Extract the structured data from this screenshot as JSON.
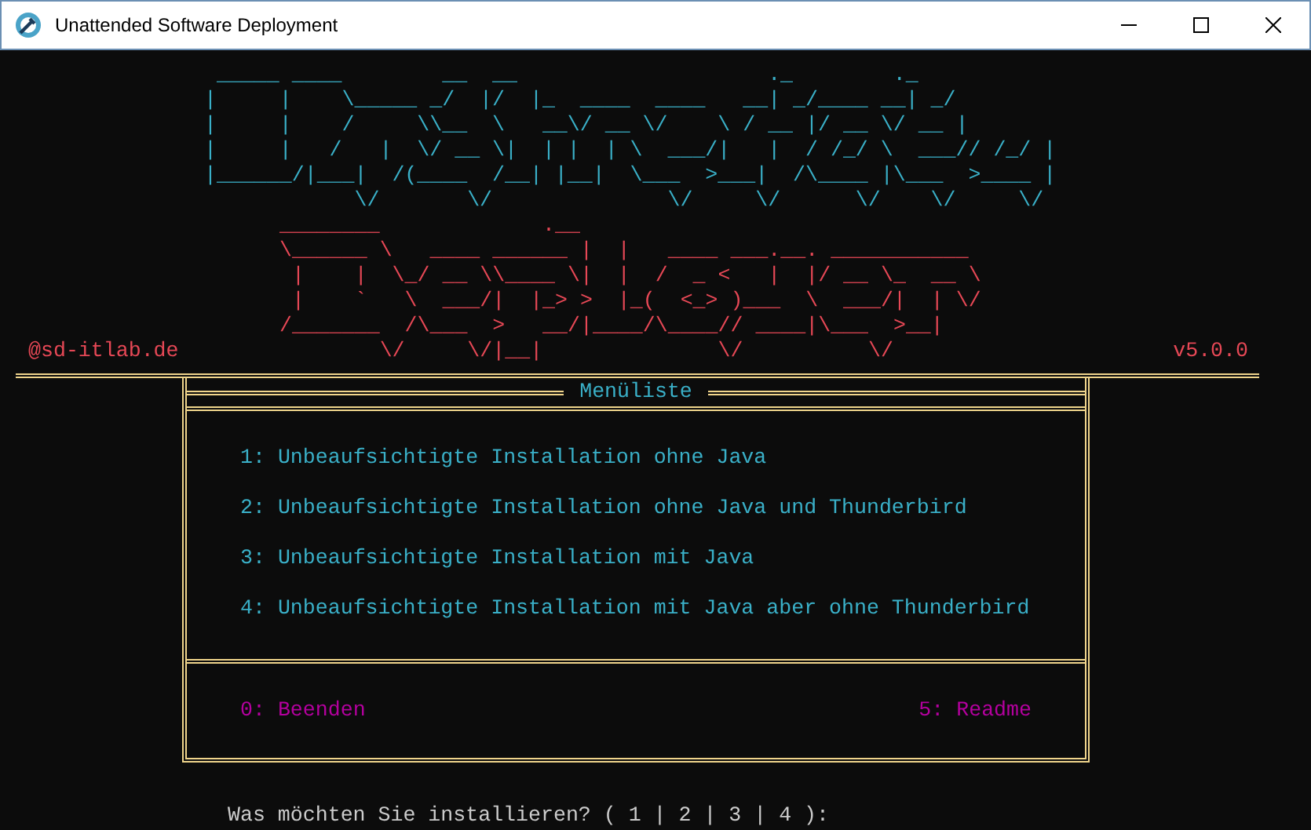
{
  "window": {
    "title": "Unattended Software Deployment"
  },
  "banner_top": [
    " _____ ____        __  __                    ._        ._",
    "|     |    \\_____ _/  |/  |_  ____  ____   __| _/____ __| _/",
    "|     |    /     \\\\__  \\   __\\/ __ \\/    \\ / __ |/ __ \\/ __ |",
    "|     |   /   |  \\/ __ \\|  | |  | \\  ___/|   |  / /_/ \\  ___// /_/ |",
    "|______/|___|  /(____  /__| |__|  \\___  >___|  /\\____ |\\___  >____ |",
    "            \\/       \\/              \\/     \\/      \\/    \\/     \\/"
  ],
  "banner_bottom": [
    " ________             .__",
    " \\______ \\   ____ ______ |  |   ____ ___.__. ___________",
    "  |    |  \\_/ __ \\\\____ \\|  |  /  _ <   |  |/ __ \\_  __ \\",
    "  |    `   \\  ___/|  |_> >  |_(  <_> )___  \\  ___/|  | \\/",
    " /_______  /\\___  >   __/|____/\\____// ____|\\___  >__|",
    "         \\/     \\/|__|              \\/          \\/"
  ],
  "tag": "@sd-itlab.de",
  "version": "v5.0.0",
  "menu": {
    "title": "Menüliste",
    "options": [
      "1: Unbeaufsichtigte Installation ohne Java",
      "2: Unbeaufsichtigte Installation ohne Java und Thunderbird",
      "3: Unbeaufsichtigte Installation mit Java",
      "4: Unbeaufsichtigte Installation mit Java aber ohne Thunderbird"
    ],
    "footer_left": "0: Beenden",
    "footer_right": "5: Readme"
  },
  "prompt": "Was möchten Sie installieren? ( 1 | 2 | 3 | 4 ):"
}
